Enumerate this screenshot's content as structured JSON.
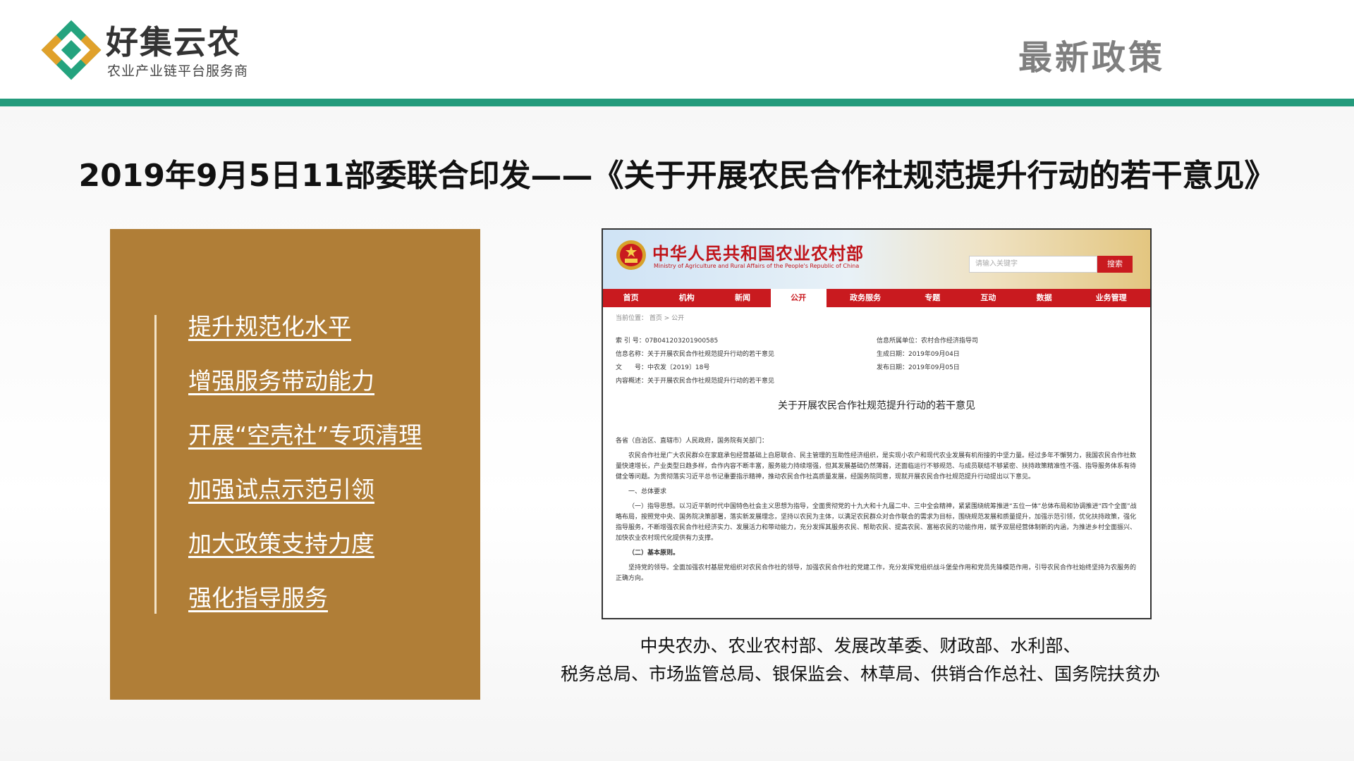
{
  "header": {
    "brand_name": "好集云农",
    "brand_subtitle": "农业产业链平台服务商",
    "section_title": "最新政策",
    "colors": {
      "accent_green": "#249b7c",
      "logo_gold": "#e0a12b",
      "logo_green": "#24a37e"
    }
  },
  "headline": "2019年9月5日11部委联合印发——《关于开展农民合作社规范提升行动的若干意见》",
  "panel": {
    "color": "#b07e37",
    "items": [
      "提升规范化水平",
      "增强服务带动能力",
      "开展“空壳社”专项清理",
      "加强试点示范引领",
      "加大政策支持力度",
      "强化指导服务"
    ]
  },
  "doc": {
    "site_title_cn": "中华人民共和国农业农村部",
    "site_title_en": "Ministry of Agriculture and Rural Affairs of the People's Republic of China",
    "search_placeholder": "请输入关键字",
    "search_button": "搜索",
    "nav": [
      "首页",
      "机构",
      "新闻",
      "公开",
      "政务服务",
      "专题",
      "互动",
      "数据",
      "业务管理"
    ],
    "breadcrumb": "当前位置： 首页 > 公开",
    "meta_left": [
      "索 引 号：07B041203201900585",
      "信息名称：关于开展农民合作社规范提升行动的若干意见",
      "文　　号：中农发〔2019〕18号",
      "内容概述：关于开展农民合作社规范提升行动的若干意见"
    ],
    "meta_right": [
      "信息所属单位：农村合作经济指导司",
      "生成日期：2019年09月04日",
      "发布日期：2019年09月05日"
    ],
    "heading": "关于开展农民合作社规范提升行动的若干意见",
    "salutation": "各省（自治区、直辖市）人民政府，国务院有关部门：",
    "para1": "农民合作社是广大农民群众在家庭承包经营基础上自愿联合、民主管理的互助性经济组织，是实现小农户和现代农业发展有机衔接的中坚力量。经过多年不懈努力，我国农民合作社数量快速增长，产业类型日趋多样，合作内容不断丰富，服务能力持续增强，但其发展基础仍然薄弱，还面临运行不够规范、与成员联结不够紧密、扶持政策精准性不强、指导服务体系有待健全等问题。为贯彻落实习近平总书记重要指示精神，推动农民合作社高质量发展，经国务院同意，现就开展农民合作社规范提升行动提出以下意见。",
    "section1": "一、总体要求",
    "para2": "（一）指导思想。以习近平新时代中国特色社会主义思想为指导，全面贯彻党的十九大和十九届二中、三中全会精神，紧紧围绕统筹推进“五位一体”总体布局和协调推进“四个全面”战略布局，按照党中央、国务院决策部署，落实新发展理念，坚持以农民为主体，以满足农民群众对合作联合的需求为目标，围绕规范发展和质量提升，加强示范引领，优化扶持政策，强化指导服务，不断增强农民合作社经济实力、发展活力和带动能力，充分发挥其服务农民、帮助农民、提高农民、富裕农民的功能作用，赋予双层经营体制新的内涵，为推进乡村全面振兴、加快农业农村现代化提供有力支撑。",
    "para3": "（二）基本原则。",
    "para4": "坚持党的领导。全面加强农村基层党组织对农民合作社的领导，加强农民合作社的党建工作，充分发挥党组织战斗堡垒作用和党员先锋模范作用，引导农民合作社始终坚持为农服务的正确方向。"
  },
  "caption": {
    "line1": "中央农办、农业农村部、发展改革委、财政部、水利部、",
    "line2": "税务总局、市场监管总局、银保监会、林草局、供销合作总社、国务院扶贫办"
  }
}
